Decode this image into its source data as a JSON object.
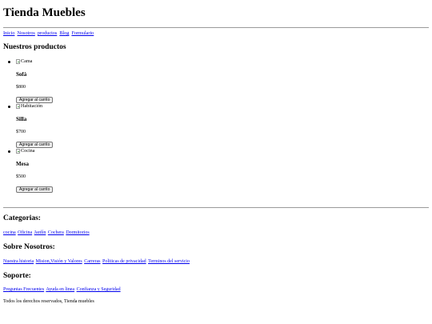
{
  "header": {
    "title": "Tienda Muebles"
  },
  "nav": {
    "items": [
      "Inicio",
      "Nosotros",
      "productos",
      "Blog",
      "Formulario"
    ]
  },
  "products": {
    "heading": "Nuestros productos",
    "items": [
      {
        "image_alt": "Cama",
        "name": "Sofá",
        "price": "$800",
        "button_label": "Agregar al carrito"
      },
      {
        "image_alt": "Habitación",
        "name": "Silla",
        "price": "$700",
        "button_label": "Agregar al carrito"
      },
      {
        "image_alt": "Cocina",
        "name": "Mesa",
        "price": "$500",
        "button_label": "Agregar al carrito"
      }
    ]
  },
  "footer": {
    "categories": {
      "heading": "Categorias:",
      "links": [
        "cocina",
        "Oficina",
        "Jardín",
        "Cochera",
        "Dormitorios"
      ]
    },
    "about": {
      "heading": "Sobre Nosotros:",
      "links": [
        "Nuestra historia",
        "Mision,Visión y Valores",
        "Carreras",
        "Politicas de privacidad",
        "Terminos del servicio"
      ]
    },
    "support": {
      "heading": "Soporte:",
      "links": [
        "Preguntas Frecuentes",
        "Ayuda en linea",
        "Confianza y Seguridad"
      ]
    },
    "copyright": "Todos los derechos reservados, Tienda muebles"
  }
}
